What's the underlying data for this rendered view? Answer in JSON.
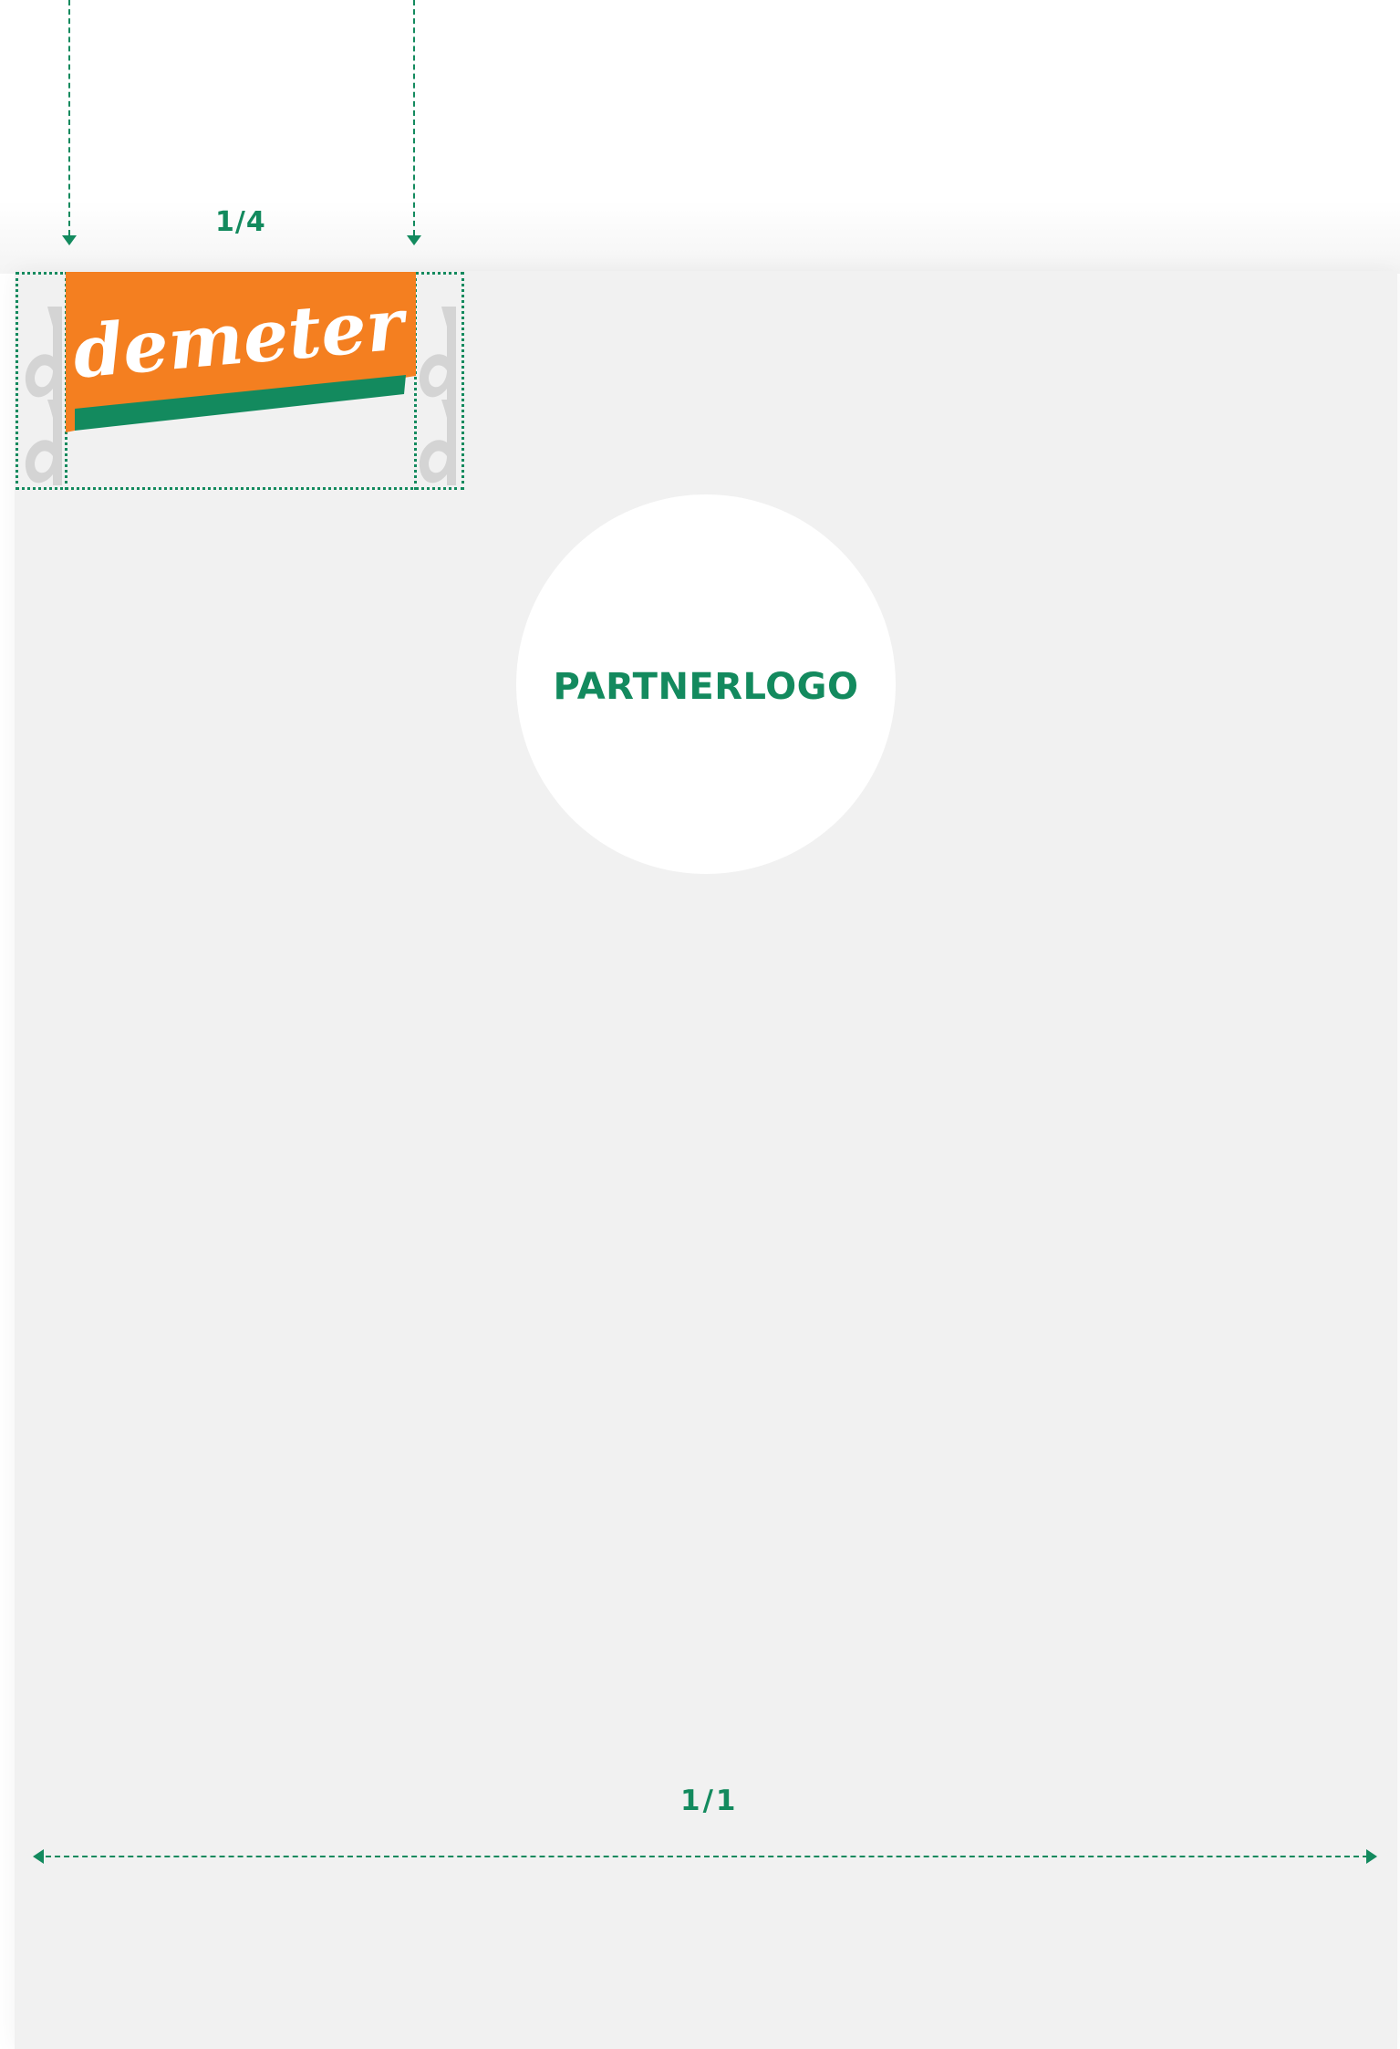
{
  "logo": {
    "wordmark": "demeter",
    "colors": {
      "orange": "#f47f20",
      "green": "#138a5e",
      "white": "#ffffff"
    }
  },
  "dimensions": {
    "top_label": "1/4",
    "bottom_label": "1/1"
  },
  "partner": {
    "placeholder_label": "PARTNERLOGO"
  },
  "colors": {
    "accent": "#138a5e",
    "sheet": "#f1f1f1",
    "protection_zone_glyph": "#d4d4d4"
  }
}
